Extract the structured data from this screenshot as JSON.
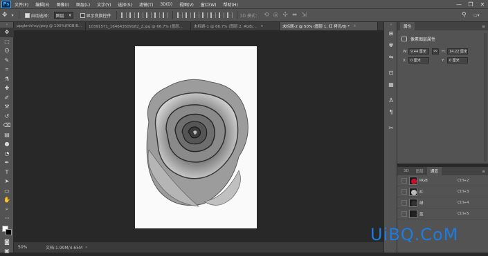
{
  "app": {
    "logo": "Ps"
  },
  "menu": [
    "文件(F)",
    "编辑(E)",
    "图像(I)",
    "图层(L)",
    "文字(Y)",
    "选择(S)",
    "滤镜(T)",
    "3D(D)",
    "视图(V)",
    "窗口(W)",
    "帮助(H)"
  ],
  "window_controls": {
    "minimize": "—",
    "restore": "❐",
    "close": "✕"
  },
  "options_bar": {
    "auto_select_label": "自动选择：",
    "auto_select_target": "图层",
    "show_transform_label": "显示变换控件",
    "mode_3d_label": "3D 模式："
  },
  "tabs": [
    {
      "label": "ppgkmhhsy.jpeg @ 100%(RGB/8...",
      "active": false
    },
    {
      "label": "10391571_164643509182_2.jpg @ 66.7% (图层...",
      "active": false
    },
    {
      "label": "未标题-1 @ 66.7% (图层 2, RGB/...",
      "active": false
    },
    {
      "label": "未标题-2 @ 50% (图层 1, 红 拷贝/8) *",
      "active": true
    }
  ],
  "tab_close": "×",
  "status": {
    "zoom": "50%",
    "doc": "文档:1.99M/4.65M",
    "arrow": "›"
  },
  "properties": {
    "tabs": [
      "属性"
    ],
    "title": "像素图层属性",
    "w_label": "W:",
    "w_value": "9.44 厘米",
    "h_label": "H:",
    "h_value": "14.22 厘米",
    "x_label": "X:",
    "x_value": "0 厘米",
    "y_label": "Y:",
    "y_value": "0 厘米",
    "link_icon": "⚯"
  },
  "channels": {
    "tabs": [
      "3D",
      "图层",
      "通道"
    ],
    "active_tab": "通道",
    "rows": [
      {
        "name": "RGB",
        "key": "Ctrl+2",
        "thumb_color": "#c8102e"
      },
      {
        "name": "红",
        "key": "Ctrl+3",
        "thumb_color": "#bbbbbb"
      },
      {
        "name": "绿",
        "key": "Ctrl+4",
        "thumb_color": "#333333"
      },
      {
        "name": "蓝",
        "key": "Ctrl+5",
        "thumb_color": "#222222"
      }
    ]
  },
  "watermark": "UiBQ.CoM",
  "colors": {
    "accent": "#31a8ff",
    "panel": "#535353",
    "canvas": "#282828",
    "watermark": "#1e7be0"
  }
}
